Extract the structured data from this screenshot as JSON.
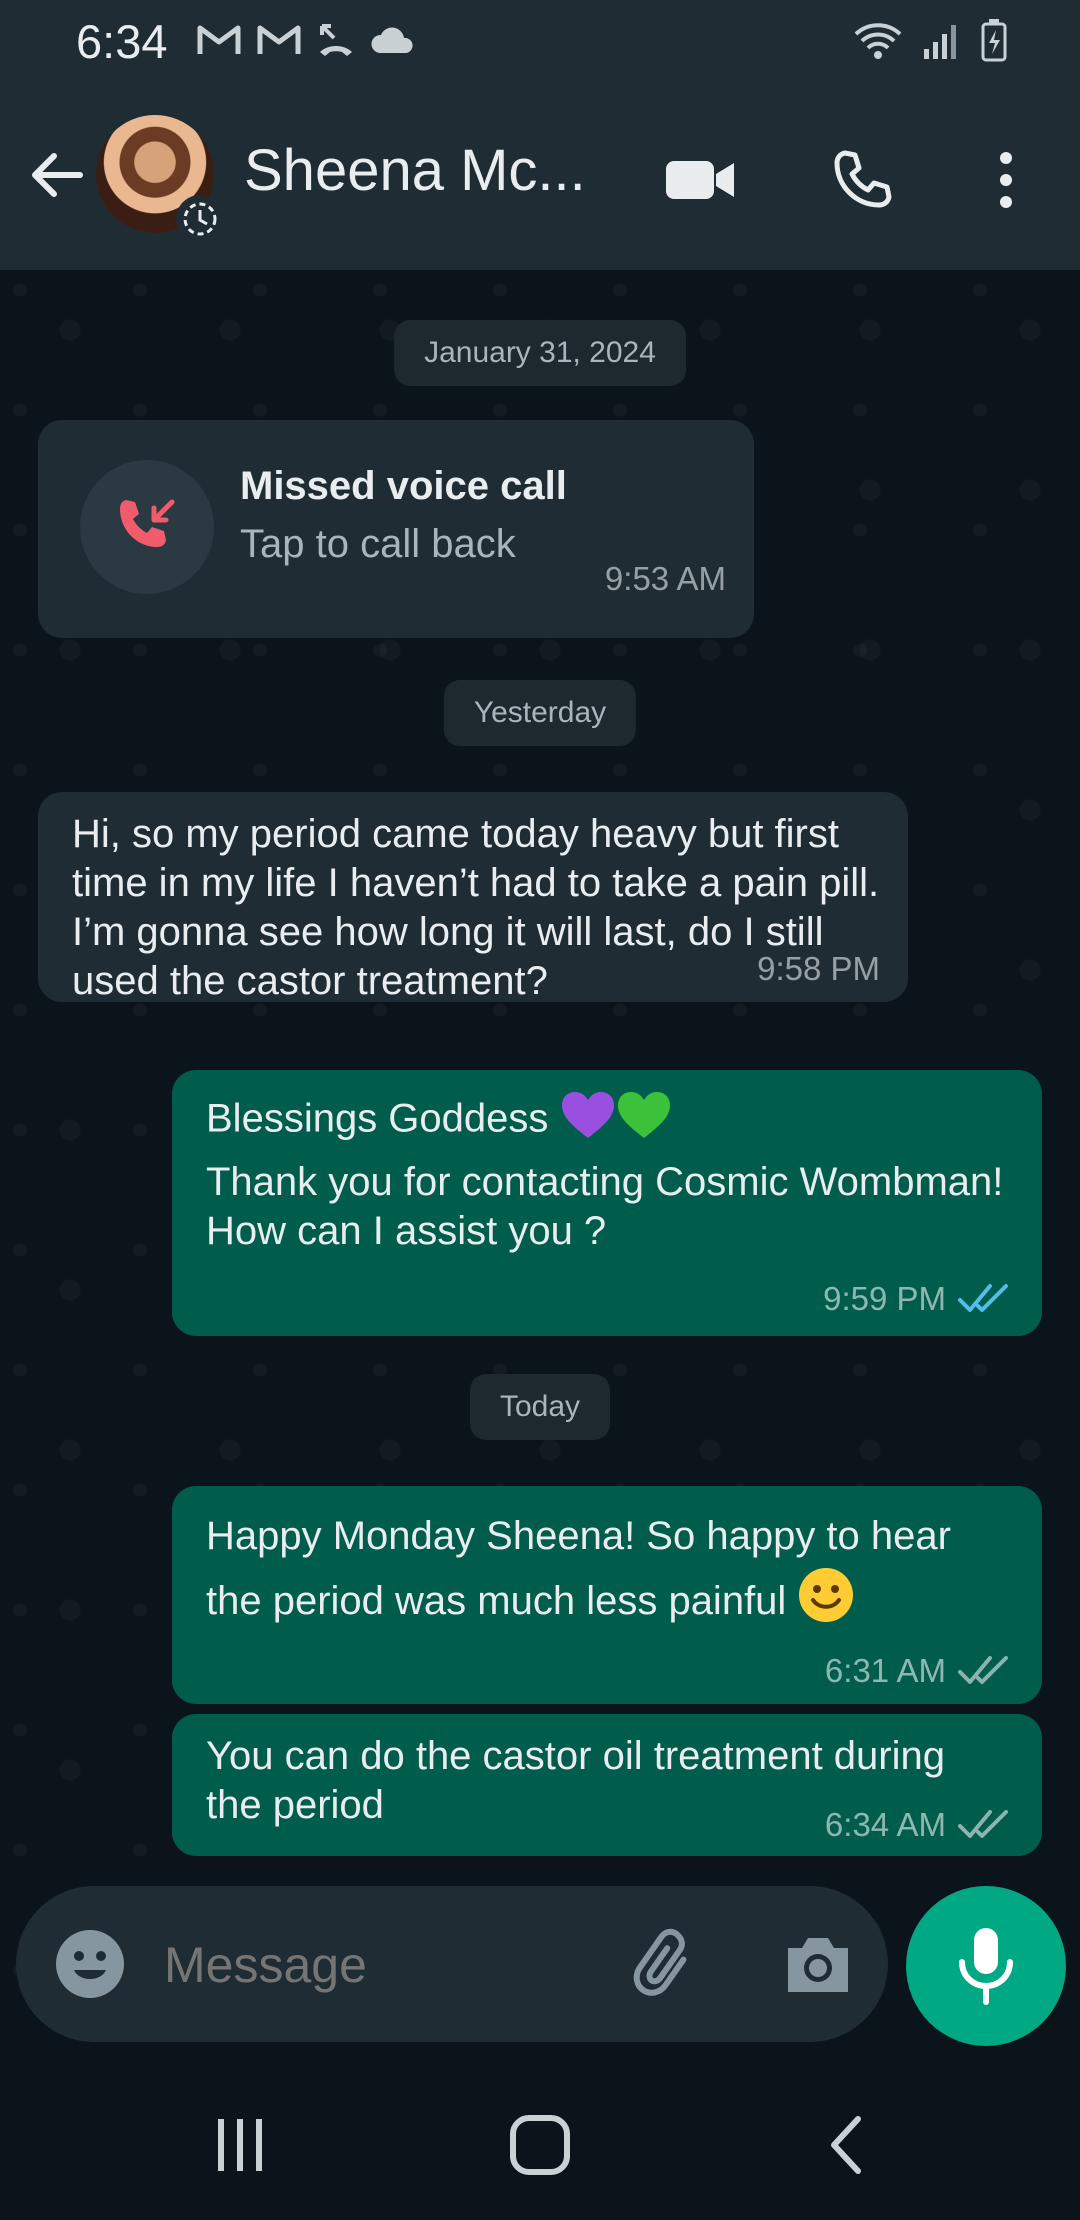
{
  "status_bar": {
    "time": "6:34",
    "left_icons": [
      "gmail-icon",
      "gmail-icon",
      "missed-call-icon",
      "cloud-icon"
    ],
    "right_icons": [
      "wifi-icon",
      "signal-icon",
      "battery-charging-icon"
    ]
  },
  "header": {
    "contact_name": "Sheena Mc...",
    "actions": [
      "video-call-icon",
      "voice-call-icon",
      "more-options-icon"
    ]
  },
  "chat": {
    "date_chips": [
      "January 31, 2024",
      "Yesterday",
      "Today"
    ],
    "missed_call": {
      "title": "Missed voice call",
      "subtitle": "Tap to call back",
      "time": "9:53 AM"
    },
    "messages": [
      {
        "direction": "incoming",
        "text": "Hi, so my period came today heavy but first time in my life I haven’t had to take a pain pill. I’m gonna see how long it will last, do I still used the castor treatment?",
        "time": "9:58 PM"
      },
      {
        "direction": "outgoing",
        "line1": "Blessings Goddess",
        "line2": "Thank you for contacting Cosmic Wombman! How can I assist you ?",
        "time": "9:59 PM",
        "status": "read"
      },
      {
        "direction": "outgoing",
        "text": "Happy Monday Sheena! So happy to hear the period was much less painful",
        "time": "6:31 AM",
        "status": "delivered"
      },
      {
        "direction": "outgoing",
        "text": "You can do the castor oil treatment during the period",
        "time": "6:34 AM",
        "status": "delivered"
      }
    ]
  },
  "composer": {
    "placeholder": "Message"
  },
  "colors": {
    "background": "#0b141a",
    "incoming_bubble": "#1f2c34",
    "outgoing_bubble": "#005c4b",
    "accent": "#00a884",
    "read_ticks": "#53bdeb"
  }
}
